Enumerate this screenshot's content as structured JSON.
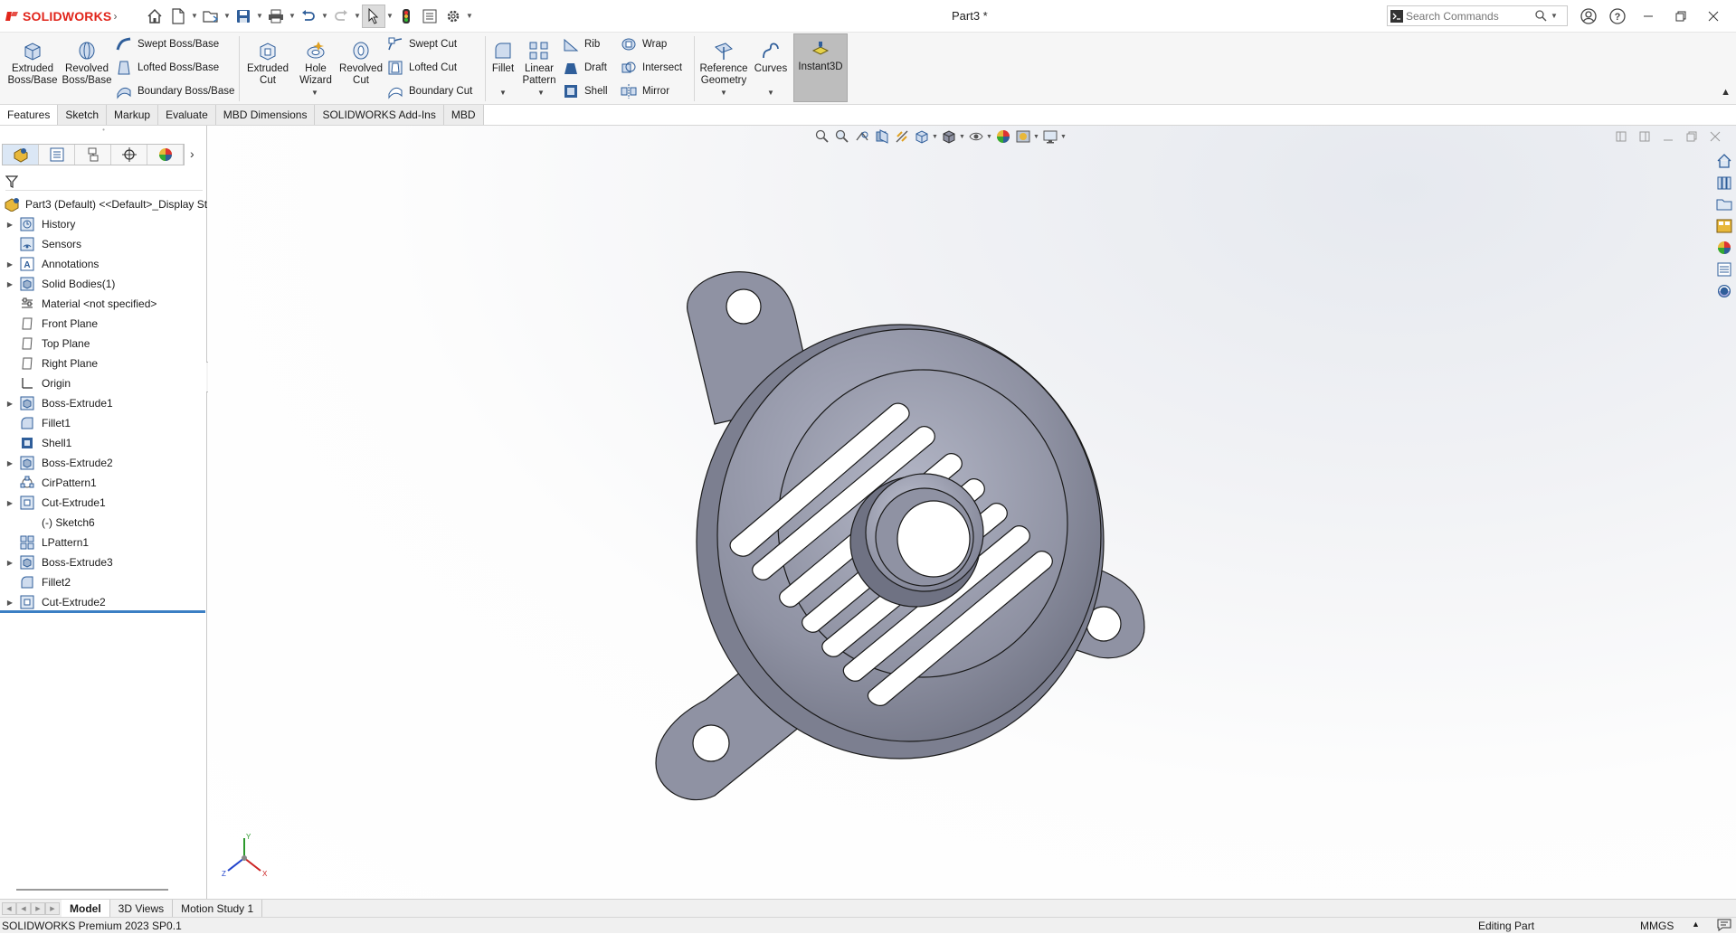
{
  "app": {
    "brand_prefix": "3S",
    "brand_name": "SOLIDWORKS",
    "document_title": "Part3 *"
  },
  "search": {
    "placeholder": "Search Commands"
  },
  "ribbon": {
    "extruded_boss": "Extruded Boss/Base",
    "revolved_boss": "Revolved Boss/Base",
    "swept_boss": "Swept Boss/Base",
    "lofted_boss": "Lofted Boss/Base",
    "boundary_boss": "Boundary Boss/Base",
    "extruded_cut": "Extruded Cut",
    "hole_wizard": "Hole Wizard",
    "revolved_cut": "Revolved Cut",
    "swept_cut": "Swept Cut",
    "lofted_cut": "Lofted Cut",
    "boundary_cut": "Boundary Cut",
    "fillet": "Fillet",
    "linear_pattern": "Linear Pattern",
    "rib": "Rib",
    "draft": "Draft",
    "shell": "Shell",
    "wrap": "Wrap",
    "intersect": "Intersect",
    "mirror": "Mirror",
    "reference_geometry": "Reference Geometry",
    "curves": "Curves",
    "instant3d": "Instant3D"
  },
  "command_tabs": [
    "Features",
    "Sketch",
    "Markup",
    "Evaluate",
    "MBD Dimensions",
    "SOLIDWORKS Add-Ins",
    "MBD"
  ],
  "feature_tree": {
    "root": "Part3 (Default) <<Default>_Display Sta",
    "items": [
      {
        "label": "History",
        "expandable": true,
        "icon": "history-icon"
      },
      {
        "label": "Sensors",
        "expandable": false,
        "icon": "sensors-icon"
      },
      {
        "label": "Annotations",
        "expandable": true,
        "icon": "annotations-icon"
      },
      {
        "label": "Solid Bodies(1)",
        "expandable": true,
        "icon": "solid-bodies-icon"
      },
      {
        "label": "Material <not specified>",
        "expandable": false,
        "icon": "material-icon"
      },
      {
        "label": "Front Plane",
        "expandable": false,
        "icon": "plane-icon"
      },
      {
        "label": "Top Plane",
        "expandable": false,
        "icon": "plane-icon"
      },
      {
        "label": "Right Plane",
        "expandable": false,
        "icon": "plane-icon"
      },
      {
        "label": "Origin",
        "expandable": false,
        "icon": "origin-icon"
      },
      {
        "label": "Boss-Extrude1",
        "expandable": true,
        "icon": "boss-extrude-icon"
      },
      {
        "label": "Fillet1",
        "expandable": false,
        "icon": "fillet-icon"
      },
      {
        "label": "Shell1",
        "expandable": false,
        "icon": "shell-icon"
      },
      {
        "label": "Boss-Extrude2",
        "expandable": true,
        "icon": "boss-extrude-icon"
      },
      {
        "label": "CirPattern1",
        "expandable": false,
        "icon": "circular-pattern-icon"
      },
      {
        "label": "Cut-Extrude1",
        "expandable": true,
        "icon": "cut-extrude-icon"
      },
      {
        "label": "(-) Sketch6",
        "expandable": false,
        "icon": "sketch-icon"
      },
      {
        "label": "LPattern1",
        "expandable": false,
        "icon": "linear-pattern-icon"
      },
      {
        "label": "Boss-Extrude3",
        "expandable": true,
        "icon": "boss-extrude-icon"
      },
      {
        "label": "Fillet2",
        "expandable": false,
        "icon": "fillet-icon"
      },
      {
        "label": "Cut-Extrude2",
        "expandable": true,
        "icon": "cut-extrude-icon"
      }
    ]
  },
  "bottom_tabs": [
    "Model",
    "3D Views",
    "Motion Study 1"
  ],
  "status": {
    "version": "SOLIDWORKS Premium 2023 SP0.1",
    "mode": "Editing Part",
    "units": "MMGS"
  },
  "colors": {
    "brand_red": "#e1251b",
    "rollback_bar": "#3b7fc4",
    "model_gray": "#8f92a3"
  }
}
